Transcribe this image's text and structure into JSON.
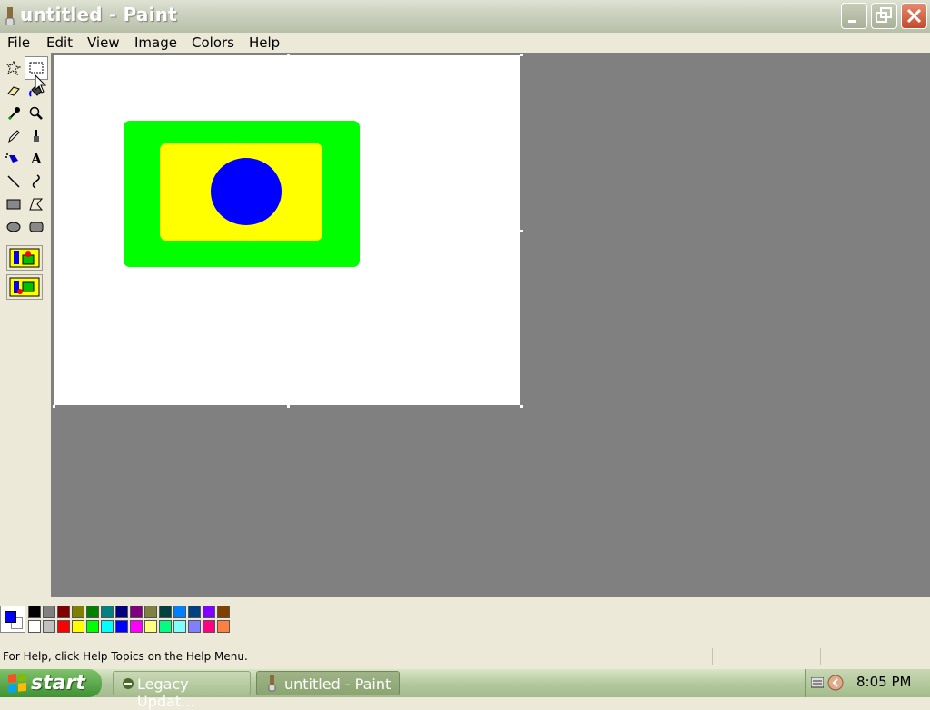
{
  "window": {
    "title": "untitled - Paint",
    "buttons": [
      "minimize",
      "maximize",
      "close"
    ]
  },
  "menu": {
    "items": [
      "File",
      "Edit",
      "View",
      "Image",
      "Colors",
      "Help"
    ]
  },
  "tools": [
    {
      "name": "free-form-select-icon"
    },
    {
      "name": "select-icon",
      "selected": true
    },
    {
      "name": "eraser-icon"
    },
    {
      "name": "fill-with-color-icon"
    },
    {
      "name": "pick-color-icon"
    },
    {
      "name": "magnifier-icon"
    },
    {
      "name": "pencil-icon"
    },
    {
      "name": "brush-icon"
    },
    {
      "name": "airbrush-icon"
    },
    {
      "name": "text-icon",
      "label": "A"
    },
    {
      "name": "line-icon"
    },
    {
      "name": "curve-icon"
    },
    {
      "name": "rectangle-icon"
    },
    {
      "name": "polygon-icon"
    },
    {
      "name": "ellipse-icon"
    },
    {
      "name": "rounded-rectangle-icon"
    }
  ],
  "canvas": {
    "background": "#ffffff",
    "shapes": [
      {
        "type": "rounded-rect",
        "color": "#00ff00"
      },
      {
        "type": "rounded-rect",
        "color": "#ffff00"
      },
      {
        "type": "ellipse",
        "color": "#0000ff"
      }
    ]
  },
  "palette": {
    "foreground": "#0000ff",
    "background": "#ffffff",
    "row1": [
      "#000000",
      "#808080",
      "#800000",
      "#808000",
      "#008000",
      "#008080",
      "#000080",
      "#800080",
      "#808040",
      "#004040",
      "#0080ff",
      "#004080",
      "#8000ff",
      "#804000"
    ],
    "row2": [
      "#ffffff",
      "#c0c0c0",
      "#ff0000",
      "#ffff00",
      "#00ff00",
      "#00ffff",
      "#0000ff",
      "#ff00ff",
      "#ffff80",
      "#00ff80",
      "#80ffff",
      "#8080ff",
      "#ff0080",
      "#ff8040"
    ]
  },
  "status": {
    "text": "For Help, click Help Topics on the Help Menu."
  },
  "taskbar": {
    "start_label": "start",
    "tasks": [
      {
        "label": "Legacy Updat...",
        "active": false
      },
      {
        "label": "untitled - Paint",
        "active": true
      }
    ],
    "clock": "8:05 PM"
  },
  "colors": {
    "workspace": "#808080",
    "face": "#ece9d8"
  }
}
